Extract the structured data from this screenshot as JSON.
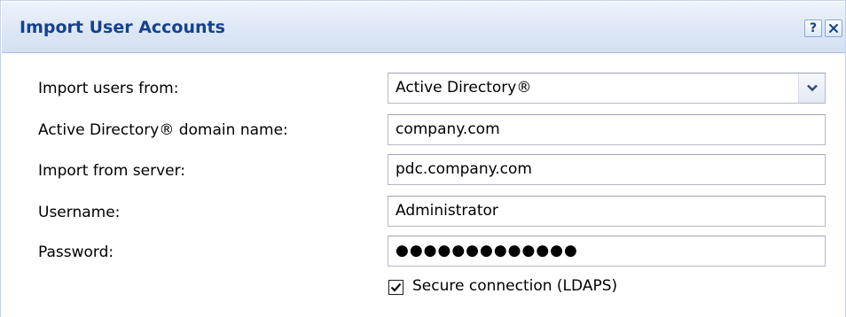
{
  "window": {
    "title": "Import User Accounts",
    "help_label": "?",
    "close_icon": "close-icon"
  },
  "form": {
    "import_from": {
      "label": "Import users from:",
      "value": "Active Directory®"
    },
    "domain_name": {
      "label": "Active Directory® domain name:",
      "value": "company.com"
    },
    "server": {
      "label": "Import from server:",
      "value": "pdc.company.com"
    },
    "username": {
      "label": "Username:",
      "value": "Administrator"
    },
    "password": {
      "label": "Password:",
      "masked_value": "●●●●●●●●●●●●●"
    },
    "secure_connection": {
      "label": "Secure connection (LDAPS)",
      "checked": true
    }
  }
}
